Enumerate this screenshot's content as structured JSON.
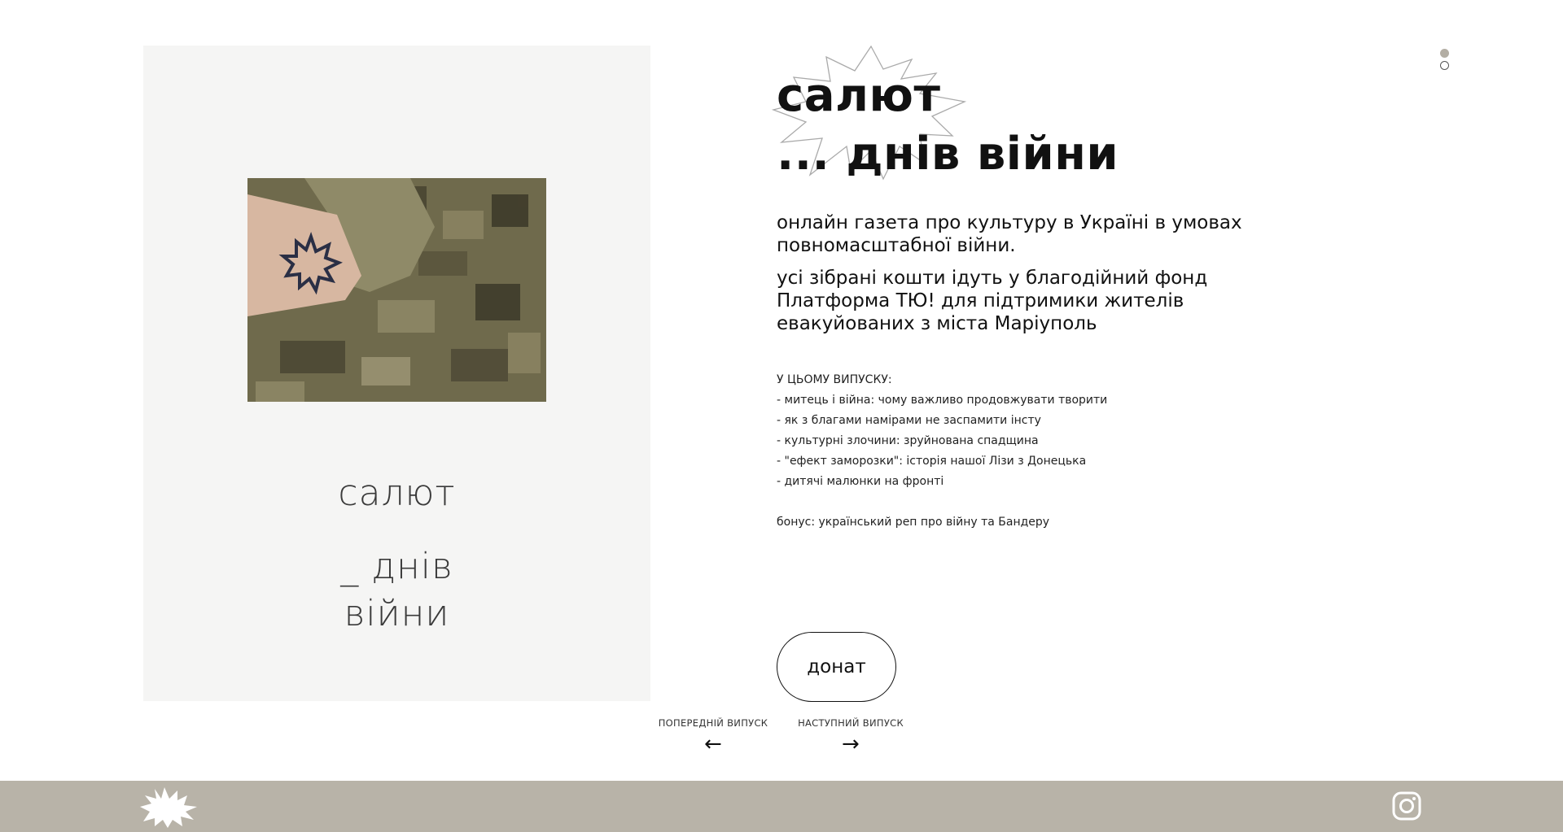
{
  "cover": {
    "title_line1": "салют",
    "title_line2": "_ днів",
    "title_line3": "війни",
    "photo_alt": "arm-with-tattoo-photo"
  },
  "heading": {
    "line1": "салют",
    "line2": "... днів війни"
  },
  "lead": {
    "p1": "онлайн газета про культуру в Україні в умовах повномасштабної війни.",
    "p2": "усі зібрані кошти ідуть у благодійний фонд Платформа ТЮ! для підтримики жителів евакуйованих з міста Маріуполь"
  },
  "issue": {
    "label": "У ЦЬОМУ ВИПУСКУ:",
    "items": [
      "- митець і війна: чому важливо продовжувати творити",
      "- як з благами намірами не заспамити інсту",
      "- культурні злочини: зруйнована спадщина",
      "- \"ефект заморозки\": історія нашої Лізи з Донецька",
      "- дитячі малюнки на фронті"
    ],
    "bonus": "бонус: український реп про війну та Бандеру"
  },
  "donate": {
    "label": "донат"
  },
  "pager": {
    "prev_label": "ПОПЕРЕДНІЙ ВИПУСК",
    "prev_arrow": "←",
    "next_label": "НАСТУПНИЙ ВИПУСК",
    "next_arrow": "→"
  },
  "footer": {
    "logo_icon": "burst-logo-icon",
    "social_icon": "instagram-icon"
  },
  "colors": {
    "footer_bg": "#b8b3a8",
    "cover_bg": "#f5f5f4",
    "dot_active": "#b3aea4"
  }
}
